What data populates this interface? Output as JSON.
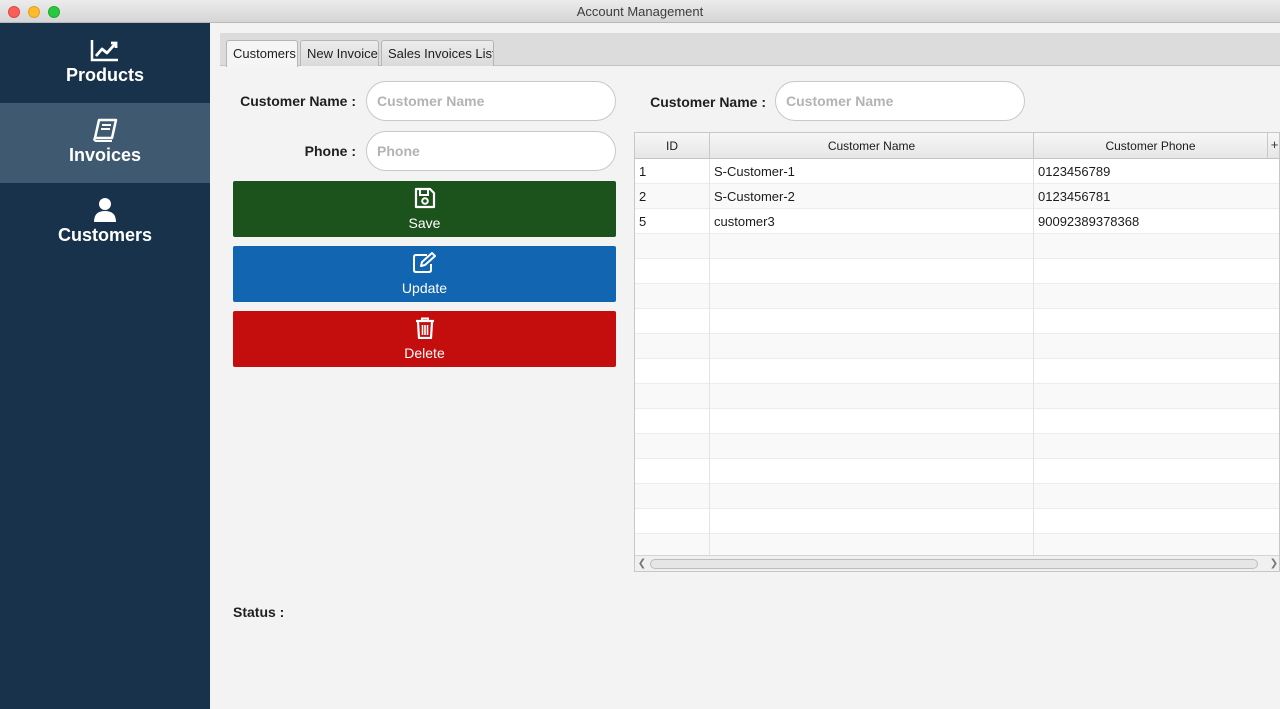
{
  "window": {
    "title": "Account Management"
  },
  "sidebar": {
    "items": [
      {
        "label": "Products",
        "icon": "chart-line-icon",
        "active": false
      },
      {
        "label": "Invoices",
        "icon": "book-icon",
        "active": true
      },
      {
        "label": "Customers",
        "icon": "user-icon",
        "active": false
      }
    ],
    "background": "#17324a",
    "active_background": "#3f5a70"
  },
  "tabs": [
    {
      "label": "Customers",
      "active": true
    },
    {
      "label": "New Invoice",
      "active": false
    },
    {
      "label": "Sales Invoices List",
      "active": false
    }
  ],
  "form": {
    "name_label": "Customer Name :",
    "name_placeholder": "Customer Name",
    "name_value": "",
    "phone_label": "Phone :",
    "phone_placeholder": "Phone",
    "phone_value": ""
  },
  "buttons": {
    "save": {
      "label": "Save",
      "icon": "floppy-disk-icon",
      "color": "#1c521c"
    },
    "update": {
      "label": "Update",
      "icon": "edit-icon",
      "color": "#1265b0"
    },
    "delete": {
      "label": "Delete",
      "icon": "trash-icon",
      "color": "#c40d0d"
    }
  },
  "search": {
    "label": "Customer Name :",
    "placeholder": "Customer Name",
    "value": ""
  },
  "table": {
    "columns": [
      "ID",
      "Customer Name",
      "Customer Phone"
    ],
    "add_column_glyph": "+",
    "rows": [
      {
        "id": "1",
        "name": "S-Customer-1",
        "phone": "0123456789"
      },
      {
        "id": "2",
        "name": "S-Customer-2",
        "phone": "0123456781"
      },
      {
        "id": "5",
        "name": "customer3",
        "phone": "90092389378368"
      }
    ]
  },
  "status": {
    "label": "Status :",
    "value": ""
  }
}
